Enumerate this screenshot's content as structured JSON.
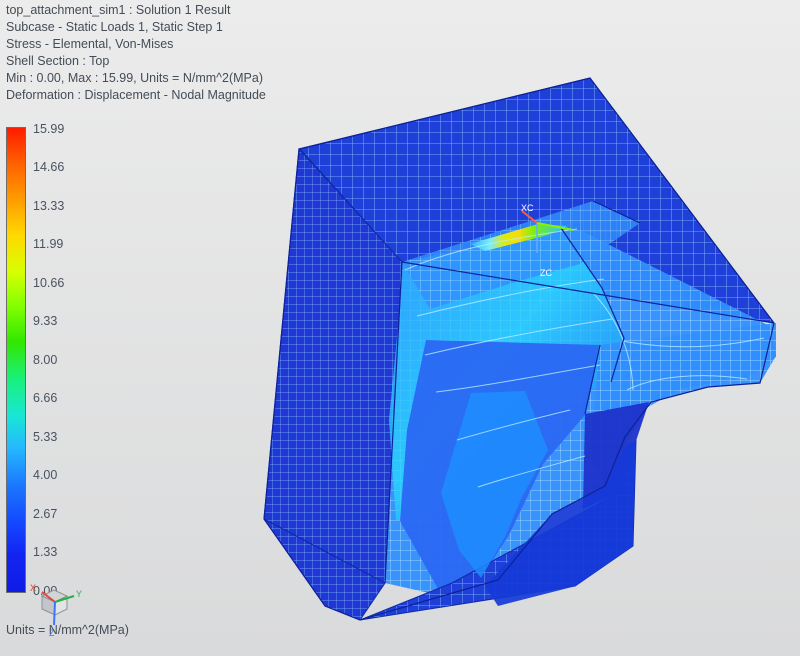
{
  "header": {
    "line1": "top_attachment_sim1 : Solution 1 Result",
    "line2": "Subcase - Static Loads 1, Static Step 1",
    "line3": "Stress - Elemental, Von-Mises",
    "line4": "Shell Section : Top",
    "line5": "Min : 0.00, Max : 15.99, Units = N/mm^2(MPa)",
    "line6": "Deformation : Displacement - Nodal Magnitude"
  },
  "legend": {
    "ticks": [
      "15.99",
      "14.66",
      "13.33",
      "11.99",
      "10.66",
      "9.33",
      "8.00",
      "6.66",
      "5.33",
      "4.00",
      "2.67",
      "1.33",
      "0.00"
    ],
    "units": "Units = N/mm^2(MPa)"
  },
  "triad": {
    "x": "X",
    "y": "Y",
    "z": "Z"
  },
  "csys": {
    "xc": "XC",
    "zc": "ZC"
  },
  "colors": {
    "base_blue": "#1f3dd8",
    "mesh_line": "#9ed2ff",
    "mid_cyan": "#3ac0ff",
    "hot_yellow": "#f2e600",
    "hot_red": "#ff2a00"
  }
}
